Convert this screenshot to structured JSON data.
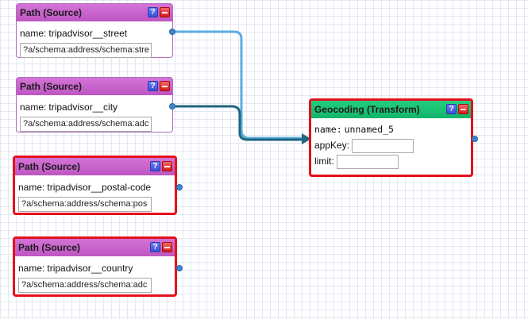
{
  "colors": {
    "source_header": "#c562c9",
    "transform_header": "#1ec576",
    "selection_border": "#e5101b",
    "wire_light": "#5aaee0",
    "wire_dark": "#1f6680",
    "port": "#3f86d1"
  },
  "sources": [
    {
      "title": "Path (Source)",
      "name_label": "name:",
      "name": "tripadvisor__street",
      "path": "?a/schema:address/schema:stre",
      "selected": false
    },
    {
      "title": "Path (Source)",
      "name_label": "name:",
      "name": "tripadvisor__city",
      "path": "?a/schema:address/schema:adc",
      "selected": false
    },
    {
      "title": "Path (Source)",
      "name_label": "name:",
      "name": "tripadvisor__postal-code",
      "path": "?a/schema:address/schema:pos",
      "selected": true
    },
    {
      "title": "Path (Source)",
      "name_label": "name:",
      "name": "tripadvisor__country",
      "path": "?a/schema:address/schema:adc",
      "selected": true
    }
  ],
  "transform": {
    "title": "Geocoding (Transform)",
    "name_label": "name:",
    "name": "unnamed_5",
    "appkey_label": "appKey:",
    "appkey_value": "",
    "limit_label": "limit:",
    "limit_value": ""
  },
  "header_buttons": {
    "help": "?",
    "close": ""
  }
}
